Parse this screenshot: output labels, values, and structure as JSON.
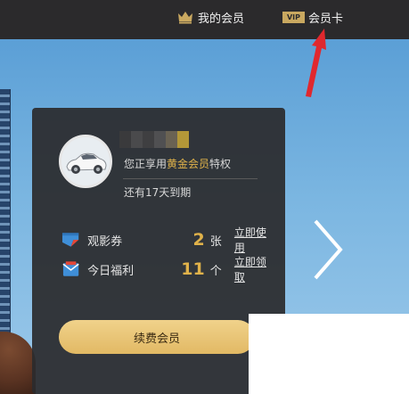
{
  "header": {
    "my_member_label": "我的会员",
    "vip_badge_text": "VIP",
    "vip_card_label": "会员卡"
  },
  "member_panel": {
    "status_prefix": "您正享用",
    "member_tier": "黄金会员",
    "status_suffix": "特权",
    "expire_text": "还有17天到期",
    "benefits": [
      {
        "label": "观影券",
        "count": "2",
        "unit": "张",
        "action": "立即使用",
        "icon": "movie-ticket-icon"
      },
      {
        "label": "今日福利",
        "count": "11",
        "unit": "个",
        "action": "立即领取",
        "icon": "gift-envelope-icon"
      }
    ],
    "renew_button_label": "续费会员"
  },
  "colors": {
    "topbar": "#2b2a2c",
    "accent_gold": "#e0b24a",
    "panel_bg": "#2b2b2d",
    "annotation_red": "#e0282e"
  }
}
